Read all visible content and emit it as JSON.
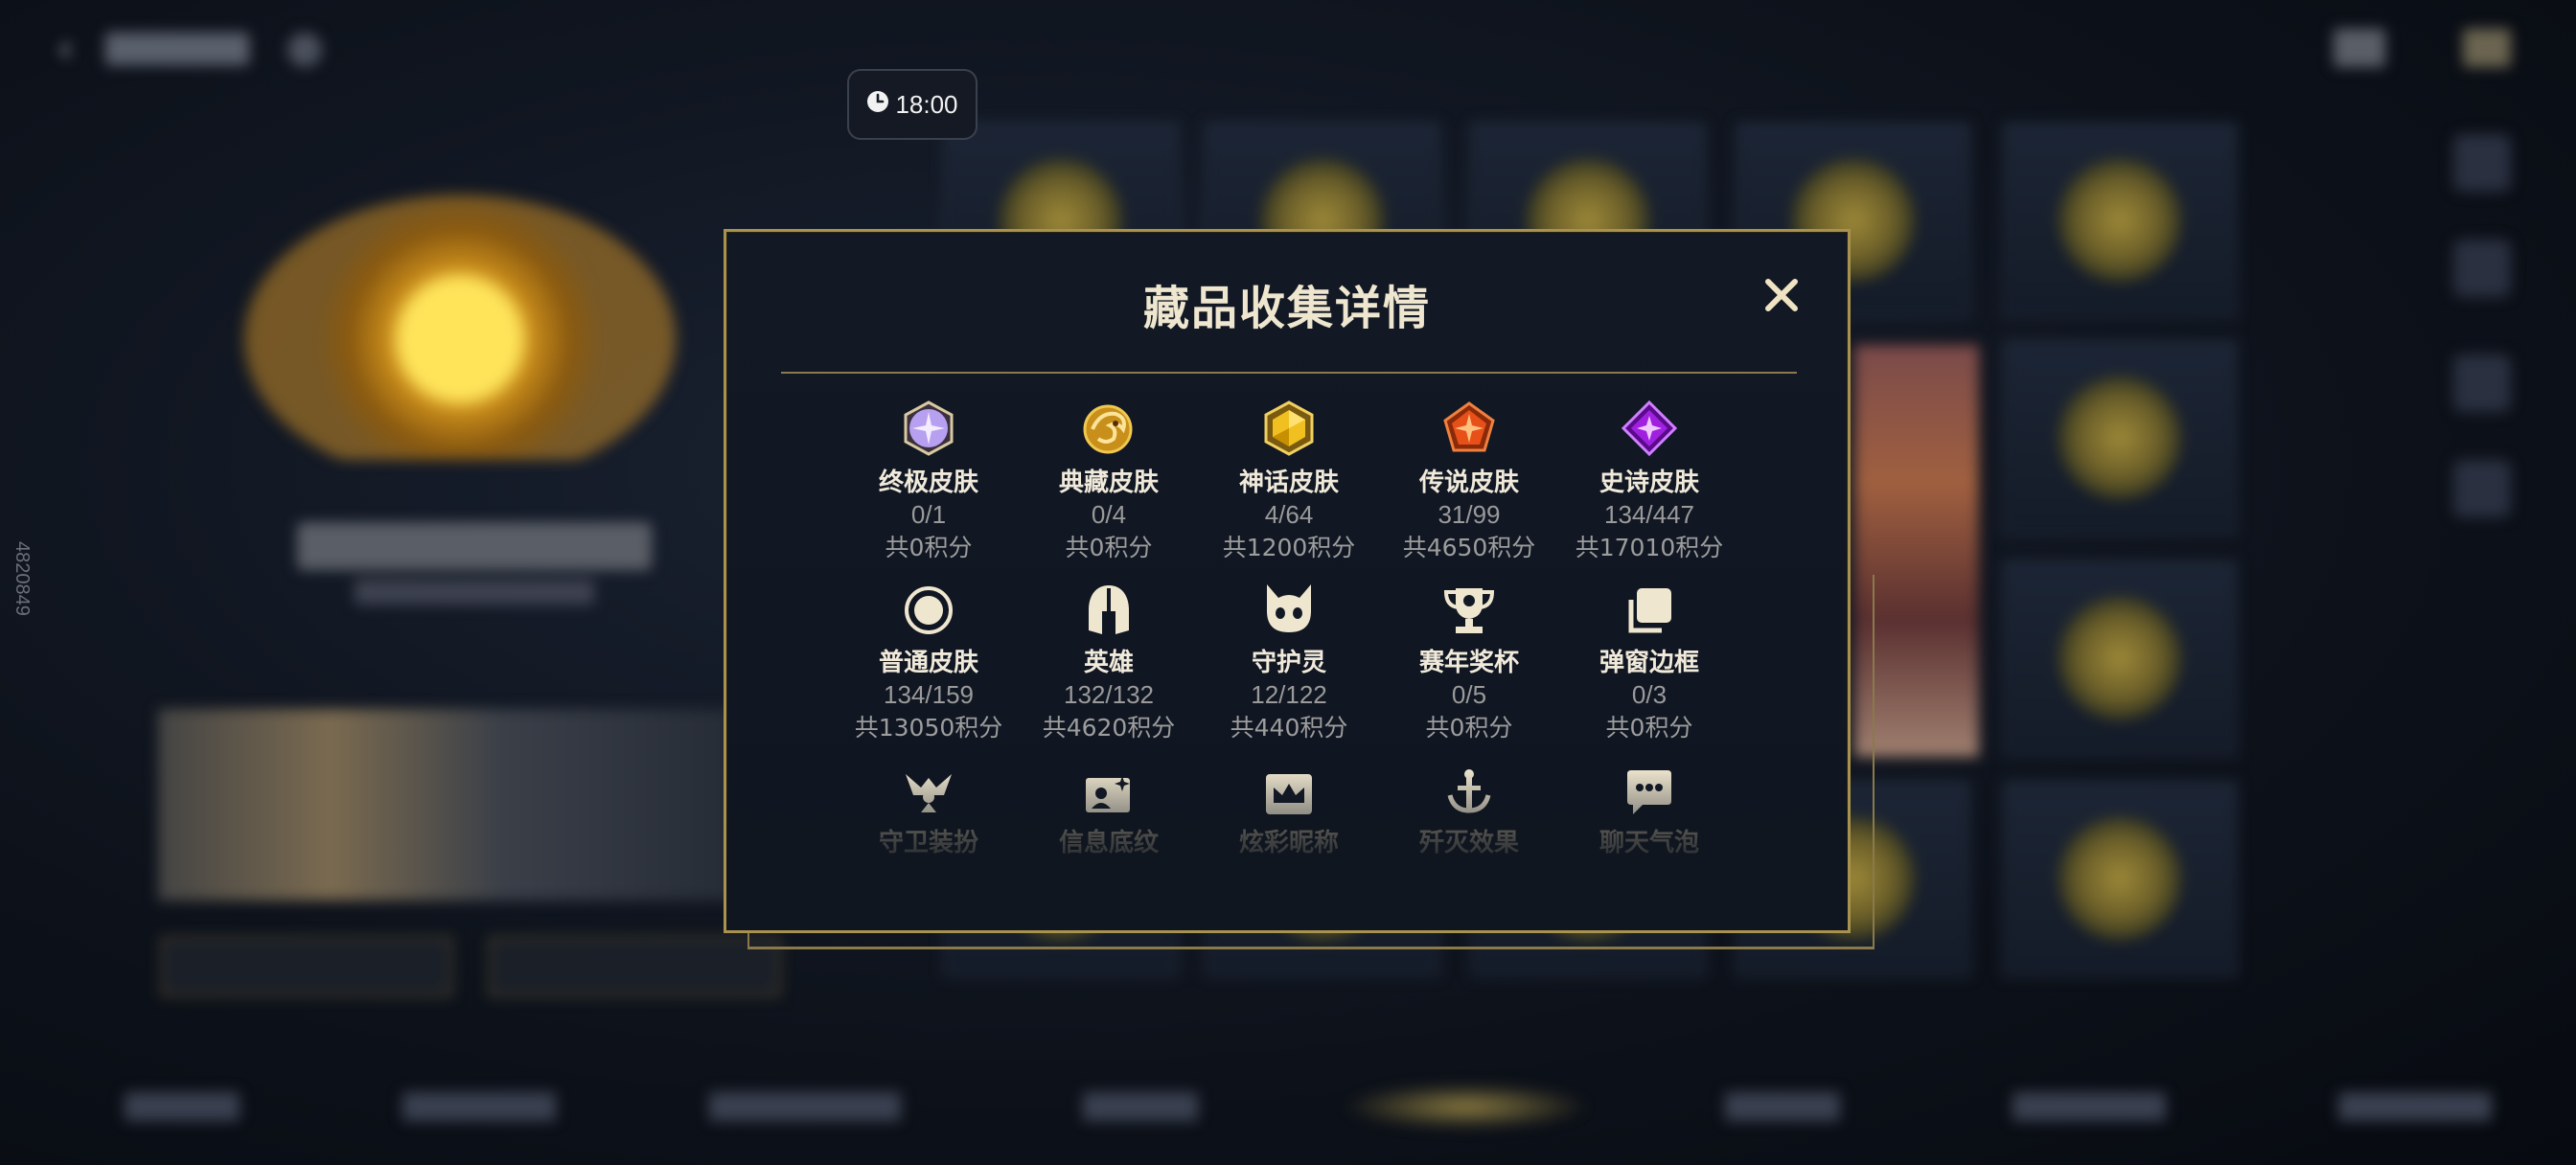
{
  "modal": {
    "title": "藏品收集详情",
    "close_symbol": "✕"
  },
  "timer": {
    "icon": "clock-icon",
    "text": "18:00"
  },
  "side_id": "4820849",
  "categories": [
    {
      "icon": "ultimate-skin-icon",
      "name": "终极皮肤",
      "count": "0/1",
      "points": "共0积分"
    },
    {
      "icon": "collection-skin-icon",
      "name": "典藏皮肤",
      "count": "0/4",
      "points": "共0积分"
    },
    {
      "icon": "myth-skin-icon",
      "name": "神话皮肤",
      "count": "4/64",
      "points": "共1200积分"
    },
    {
      "icon": "legend-skin-icon",
      "name": "传说皮肤",
      "count": "31/99",
      "points": "共4650积分"
    },
    {
      "icon": "epic-skin-icon",
      "name": "史诗皮肤",
      "count": "134/447",
      "points": "共17010积分"
    },
    {
      "icon": "normal-skin-icon",
      "name": "普通皮肤",
      "count": "134/159",
      "points": "共13050积分"
    },
    {
      "icon": "hero-helmet-icon",
      "name": "英雄",
      "count": "132/132",
      "points": "共4620积分"
    },
    {
      "icon": "guardian-spirit-icon",
      "name": "守护灵",
      "count": "12/122",
      "points": "共440积分"
    },
    {
      "icon": "trophy-icon",
      "name": "赛年奖杯",
      "count": "0/5",
      "points": "共0积分"
    },
    {
      "icon": "popup-frame-icon",
      "name": "弹窗边框",
      "count": "0/3",
      "points": "共0积分"
    },
    {
      "icon": "guard-outfit-icon",
      "name": "守卫装扮"
    },
    {
      "icon": "info-pattern-icon",
      "name": "信息底纹"
    },
    {
      "icon": "colorful-nickname-icon",
      "name": "炫彩昵称"
    },
    {
      "icon": "annihilation-effect-icon",
      "name": "歼灭效果"
    },
    {
      "icon": "chat-bubble-icon",
      "name": "聊天气泡"
    }
  ],
  "colors": {
    "gold_border": "#a8924e",
    "modal_bg": "#121925",
    "title_text": "#efe6cf",
    "ultimate": "#c8a8ff",
    "myth": "#f0c020",
    "legend": "#e8501a",
    "epic": "#a020e0"
  }
}
